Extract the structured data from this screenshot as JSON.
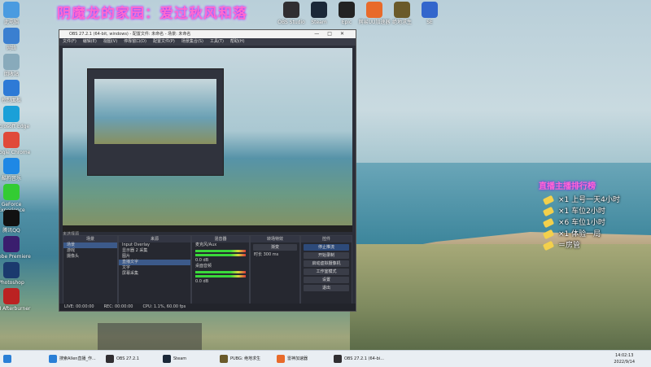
{
  "banner": "阴魔龙的家园：爱过秋风和落",
  "desktop_icons": [
    {
      "label": "此电脑",
      "color": "#4a9be0"
    },
    {
      "label": "网络",
      "color": "#3a7fd0"
    },
    {
      "label": "回收站",
      "color": "#8ab"
    },
    {
      "label": "控制面板",
      "color": "#2e7ad6"
    },
    {
      "label": "Microsoft Edge",
      "color": "#1aa0d8"
    },
    {
      "label": "Google Chrome",
      "color": "#e04a3a"
    },
    {
      "label": "酷狗音乐",
      "color": "#1e88e5"
    },
    {
      "label": "GeForce Experience",
      "color": "#3c3"
    },
    {
      "label": "腾讯QQ",
      "color": "#111"
    },
    {
      "label": "Adobe Premiere",
      "color": "#3a1e6e"
    },
    {
      "label": "Photoshop",
      "color": "#1b3a6e"
    },
    {
      "label": "MSI Afterburner",
      "color": "#b22"
    }
  ],
  "top_icons": [
    {
      "label": "OBS Studio",
      "color": "#302e31"
    },
    {
      "label": "Steam",
      "color": "#1b2838"
    },
    {
      "label": "Epic",
      "color": "#222"
    },
    {
      "label": "网易UU加速器",
      "color": "#e86a2a"
    },
    {
      "label": "绝地求生",
      "color": "#6a5a2a"
    },
    {
      "label": "SE",
      "color": "#36c"
    }
  ],
  "obs": {
    "title": "OBS 27.2.1 (64-bit, windows) - 配置文件: 未命名 - 场景: 未命名",
    "menu": [
      "文件(F)",
      "编辑(E)",
      "视图(V)",
      "停靠窗口(D)",
      "配置文件(P)",
      "场景集合(S)",
      "工具(T)",
      "帮助(H)"
    ],
    "not_selected": "未选择源",
    "scenes_header": "场景",
    "scenes": [
      "场景",
      "游戏",
      "摄像头"
    ],
    "sources_header": "来源",
    "sources": [
      "Input Overlay",
      "显示器 2 采集",
      "图片",
      "直播文字",
      "文字",
      "屏幕采集"
    ],
    "mixer_header": "混音器",
    "mixer": [
      {
        "name": "桌面音频",
        "db": "0.0 dB"
      },
      {
        "name": "麦克风/Aux",
        "db": "0.0 dB"
      }
    ],
    "transition_header": "转场特效",
    "transition": {
      "type": "渐变",
      "duration_label": "时长",
      "duration": "300 ms"
    },
    "controls_header": "控件",
    "controls": [
      "停止推流",
      "开始录制",
      "启动虚拟摄像机",
      "工作室模式",
      "设置",
      "退出"
    ],
    "status": [
      "LIVE: 00:00:00",
      "REC: 00:00:00",
      "CPU: 1.1%, 60.00 fps"
    ]
  },
  "rank": {
    "header": "直播主播排行榜",
    "rows": [
      "×1 上号一天4小时",
      "×1 车位2小时",
      "×6 车位1小时",
      "×1 体验一局",
      "＝房管"
    ]
  },
  "taskbar": {
    "items": [
      "搜索Allen直播_作...",
      "OBS 27.2.1",
      "Steam",
      "PUBG: 绝地求生",
      "雷神加速器",
      "OBS 27.2.1 (64-bi..."
    ],
    "time": "14:02:13",
    "date": "2022/9/14"
  }
}
